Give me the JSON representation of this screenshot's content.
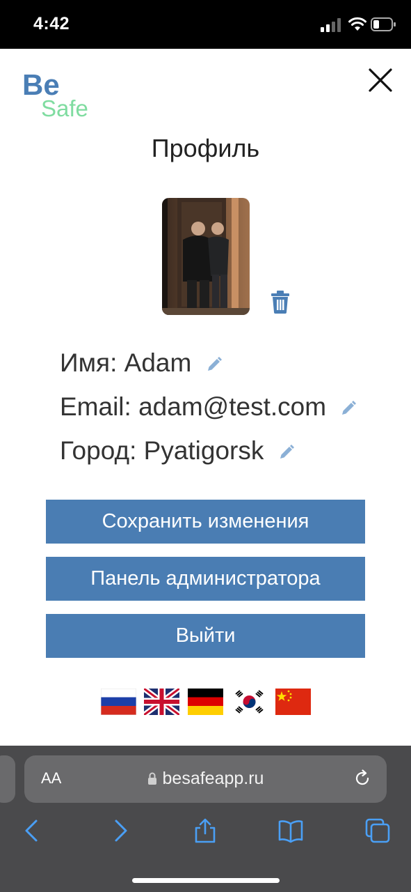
{
  "status_bar": {
    "time": "4:42"
  },
  "logo": {
    "line1": "Be",
    "line2": "Safe"
  },
  "page": {
    "title": "Профиль"
  },
  "profile": {
    "name_label": "Имя:",
    "name_value": "Adam",
    "email_label": "Email:",
    "email_value": "adam@test.com",
    "city_label": "Город:",
    "city_value": "Pyatigorsk"
  },
  "buttons": {
    "save": "Сохранить изменения",
    "admin": "Панель администратора",
    "logout": "Выйти"
  },
  "languages": [
    "ru",
    "en",
    "de",
    "ko",
    "zh"
  ],
  "browser": {
    "aa_label": "AA",
    "url": "besafeapp.ru"
  },
  "colors": {
    "primary": "#4a7db3",
    "logo_be": "#4a7eb5",
    "logo_safe": "#7fdca0",
    "safari_bar": "#4a4a4c",
    "safari_accent": "#4a9ff5"
  }
}
